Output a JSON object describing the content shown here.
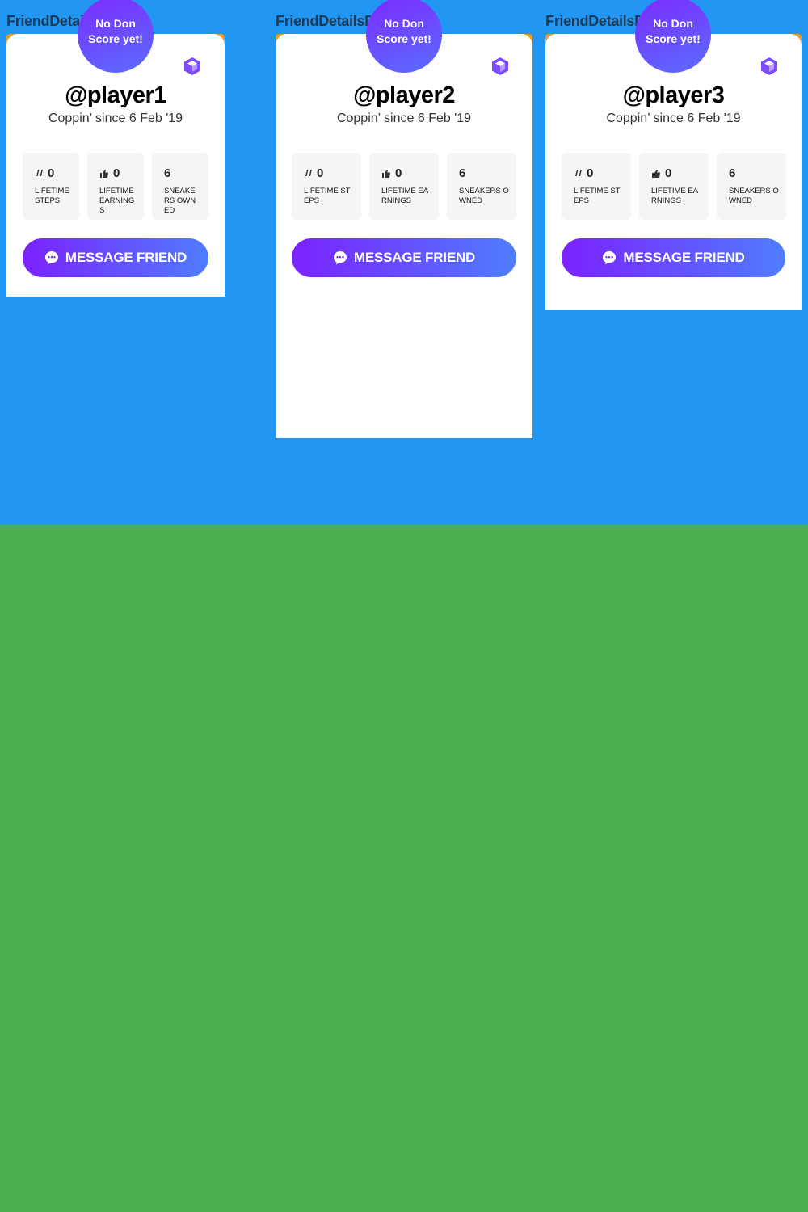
{
  "colors": {
    "top_background": "#2196f3",
    "bottom_background": "#4caf50",
    "accent_orange": "#f39a1e",
    "badge_gradient_start": "#7c2bff",
    "badge_gradient_end": "#5a6dff",
    "button_gradient_start": "#7b22ff",
    "button_gradient_end": "#4f7dff"
  },
  "icons": {
    "stat_steps": "footsteps-icon",
    "stat_earnings": "thumbs-up-icon",
    "brand": "cube-icon",
    "message": "chat-bubble-icon"
  },
  "cards": [
    {
      "column_label": "FriendDetai",
      "badge_line1": "No Don",
      "badge_line2": "Score yet!",
      "username": "@player1",
      "since": "Coppin’ since 6 Feb '19",
      "stats": [
        {
          "value": "0",
          "label": "LIFETIME STEPS"
        },
        {
          "value": "0",
          "label": "LIFETIME EARNINGS"
        },
        {
          "value": "6",
          "label": "SNEAKERS OWNED"
        }
      ],
      "message_button": "MESSAGE FRIEND"
    },
    {
      "column_label": "FriendDetailsD",
      "badge_line1": "No Don",
      "badge_line2": "Score yet!",
      "username": "@player2",
      "since": "Coppin’ since 6 Feb '19",
      "stats": [
        {
          "value": "0",
          "label": "LIFETIME STEPS"
        },
        {
          "value": "0",
          "label": "LIFETIME EARNINGS"
        },
        {
          "value": "6",
          "label": "SNEAKERS OWNED"
        }
      ],
      "message_button": "MESSAGE FRIEND"
    },
    {
      "column_label": "FriendDetailsD",
      "badge_line1": "No Don",
      "badge_line2": "Score yet!",
      "username": "@player3",
      "since": "Coppin’ since 6 Feb '19",
      "stats": [
        {
          "value": "0",
          "label": "LIFETIME STEPS"
        },
        {
          "value": "0",
          "label": "LIFETIME EARNINGS"
        },
        {
          "value": "6",
          "label": "SNEAKERS OWNED"
        }
      ],
      "message_button": "MESSAGE FRIEND"
    }
  ]
}
